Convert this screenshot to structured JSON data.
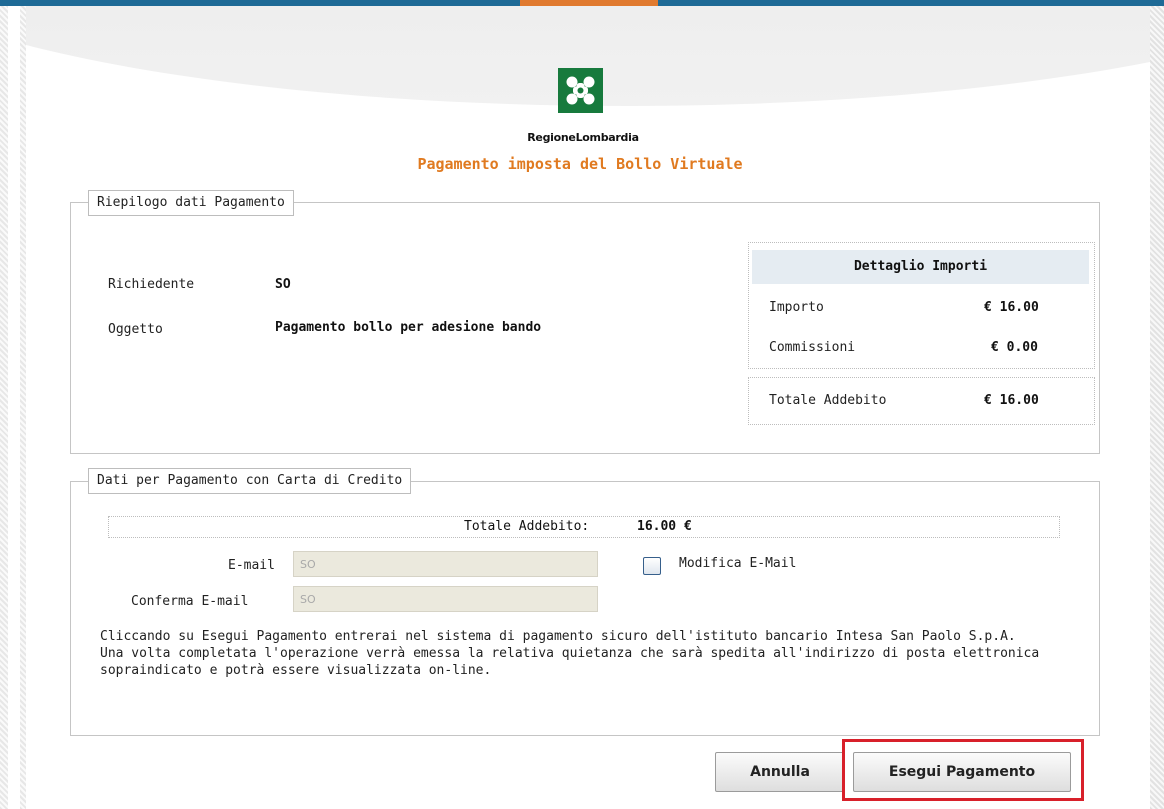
{
  "header": {
    "logo_text": "RegioneLombardia",
    "title": "Pagamento imposta del Bollo Virtuale"
  },
  "summary": {
    "legend": "Riepilogo dati Pagamento",
    "requester_label": "Richiedente",
    "requester_value": "SO",
    "subject_label": "Oggetto",
    "subject_value": "Pagamento bollo per adesione bando",
    "details": {
      "heading": "Dettaglio Importi",
      "amount_label": "Importo",
      "amount_value": "€ 16.00",
      "fees_label": "Commissioni",
      "fees_value": "€ 0.00",
      "total_label": "Totale Addebito",
      "total_value": "€ 16.00"
    }
  },
  "card": {
    "legend": "Dati per Pagamento con Carta di Credito",
    "total_label": "Totale Addebito:",
    "total_value": "16.00 €",
    "email_label": "E-mail",
    "email_value": "SO",
    "confirm_label": "Conferma E-mail",
    "confirm_value": "SO",
    "modify_label": "Modifica E-Mail",
    "modify_checked": false,
    "info_line1": "Cliccando su Esegui Pagamento entrerai nel sistema di pagamento sicuro dell'istituto bancario Intesa San Paolo S.p.A.",
    "info_line2": "Una volta completata l'operazione verrà emessa la relativa quietanza che sarà spedita all'indirizzo di posta elettronica sopraindicato e potrà essere visualizzata on-line."
  },
  "actions": {
    "cancel_label": "Annulla",
    "pay_label": "Esegui Pagamento"
  },
  "colors": {
    "title": "#e07a20",
    "highlight": "#d8202a",
    "logo_green": "#177a3d",
    "topbar": "#1e6a96"
  }
}
